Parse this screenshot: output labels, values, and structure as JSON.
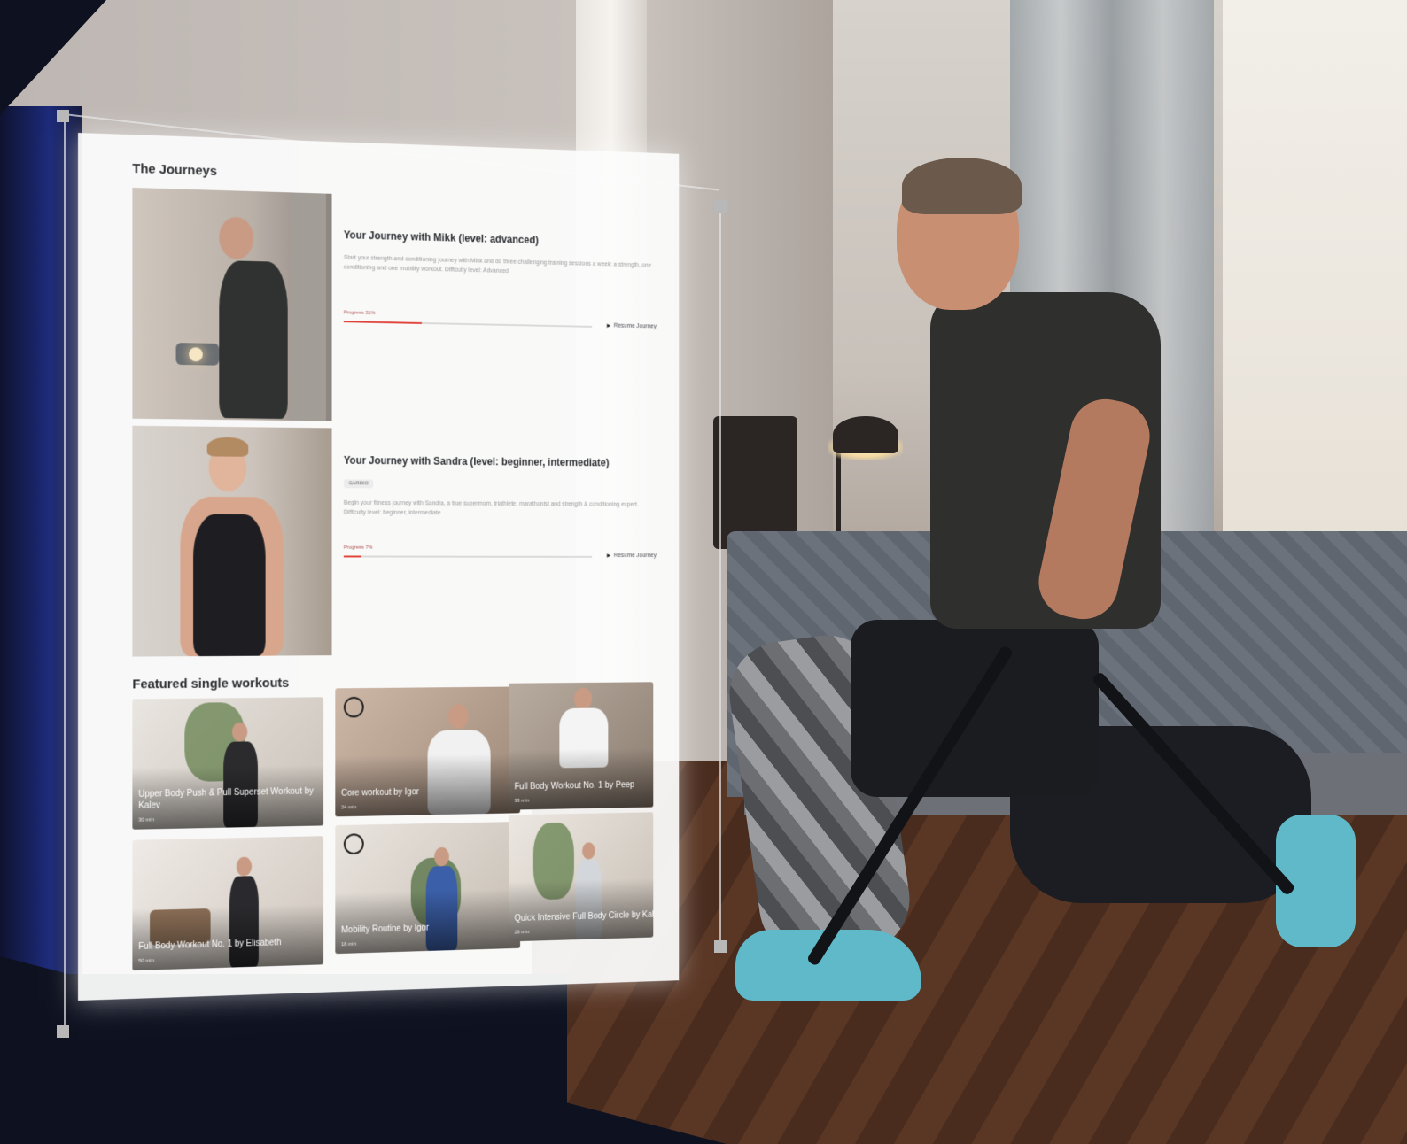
{
  "journeys_section": {
    "title": "The Journeys",
    "items": [
      {
        "title": "Your Journey with Mikk (level: advanced)",
        "tag": "",
        "description": "Start your strength and conditioning journey with Mikk and do three challenging training sessions a week: a strength, one conditioning and one mobility workout. Difficulty level: Advanced",
        "progress_label": "Progress 31%",
        "progress": 0.31,
        "resume_label": "Resume Journey"
      },
      {
        "title": "Your Journey with Sandra (level: beginner, intermediate)",
        "tag": "CARDIO",
        "description": "Begin your fitness journey with Sandra, a true supermom, triathlete, marathonist and strength & conditioning expert. Difficulty level: beginner, intermediate",
        "progress_label": "Progress 7%",
        "progress": 0.07,
        "resume_label": "Resume Journey"
      }
    ]
  },
  "featured_section": {
    "title": "Featured single workouts",
    "cards": [
      {
        "title": "Upper Body Push & Pull Superset Workout by Kalev",
        "duration": "30 min"
      },
      {
        "title": "Core workout by Igor",
        "duration": "24 min"
      },
      {
        "title": "Full Body Workout No. 1 by Peep",
        "duration": "33 min"
      },
      {
        "title": "Full Body Workout No. 1 by Elisabeth",
        "duration": "50 min"
      },
      {
        "title": "Mobility Routine by Igor",
        "duration": "18 min"
      },
      {
        "title": "Quick Intensive Full Body Circle by Kalev",
        "duration": "28 min"
      }
    ]
  },
  "colors": {
    "accent": "#e0443a",
    "dark_bg": "#0e1220"
  }
}
